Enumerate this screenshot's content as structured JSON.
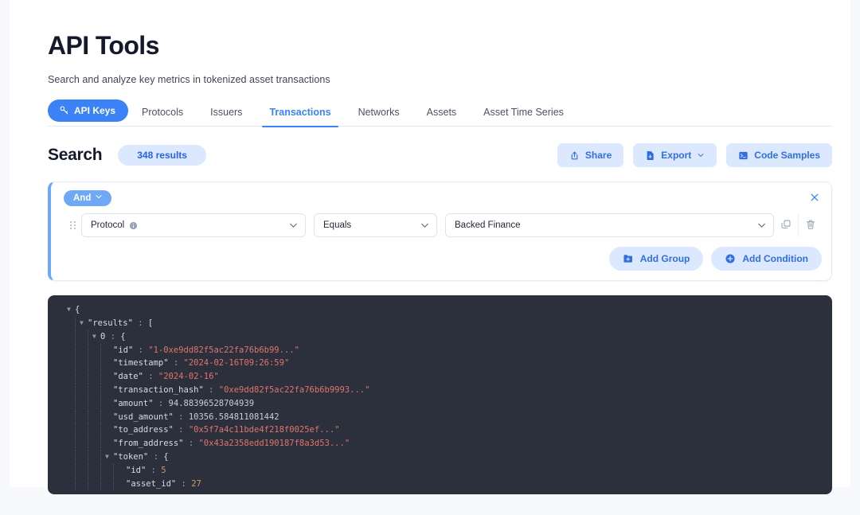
{
  "header": {
    "title": "API Tools",
    "subtitle": "Search and analyze key metrics in tokenized asset transactions"
  },
  "tabs": {
    "pill": {
      "label": "API Keys",
      "icon": "key-icon"
    },
    "items": [
      {
        "label": "Protocols",
        "active": false
      },
      {
        "label": "Issuers",
        "active": false
      },
      {
        "label": "Transactions",
        "active": true
      },
      {
        "label": "Networks",
        "active": false
      },
      {
        "label": "Assets",
        "active": false
      },
      {
        "label": "Asset Time Series",
        "active": false
      }
    ]
  },
  "search": {
    "label": "Search",
    "results_badge": "348 results",
    "actions": [
      {
        "label": "Share",
        "icon": "share-upload-icon"
      },
      {
        "label": "Export",
        "icon": "file-download-icon",
        "caret": true
      },
      {
        "label": "Code Samples",
        "icon": "terminal-icon"
      }
    ]
  },
  "query_builder": {
    "combinator": "And",
    "close_label": "✕",
    "condition": {
      "field": "Protocol",
      "field_info_tooltip": "info-icon",
      "operator": "Equals",
      "value": "Backed Finance",
      "duplicate_icon": "copy-icon",
      "delete_icon": "trash-icon",
      "drag_icon": "drag-handle-icon"
    },
    "add_group_label": "Add Group",
    "add_condition_label": "Add Condition"
  },
  "json_viewer": {
    "lines": [
      {
        "indent": 0,
        "tri": "down",
        "html": "<span class=\"brk\">{</span>"
      },
      {
        "indent": 1,
        "tri": "down",
        "html": "<span class=\"k\">\"results\"</span><span class=\"p\"> : </span><span class=\"brk\">[</span>"
      },
      {
        "indent": 2,
        "tri": "down",
        "html": "<span class=\"k\">0</span><span class=\"p\"> : </span><span class=\"brk\">{</span>"
      },
      {
        "indent": 3,
        "tri": "none",
        "html": "<span class=\"k\">\"id\"</span><span class=\"p\"> : </span><span class=\"str\">\"1-0xe9dd82f5ac22fa76b6b99...\"</span>"
      },
      {
        "indent": 3,
        "tri": "none",
        "html": "<span class=\"k\">\"timestamp\"</span><span class=\"p\"> : </span><span class=\"str\">\"2024-02-16T09:26:59\"</span>"
      },
      {
        "indent": 3,
        "tri": "none",
        "html": "<span class=\"k\">\"date\"</span><span class=\"p\"> : </span><span class=\"str\">\"2024-02-16\"</span>"
      },
      {
        "indent": 3,
        "tri": "none",
        "html": "<span class=\"k\">\"transaction_hash\"</span><span class=\"p\"> : </span><span class=\"str\">\"0xe9dd82f5ac22fa76b6b9993...\"</span>"
      },
      {
        "indent": 3,
        "tri": "none",
        "html": "<span class=\"k\">\"amount\"</span><span class=\"p\"> : </span><span class=\"numf\">94.88396528704939</span>"
      },
      {
        "indent": 3,
        "tri": "none",
        "html": "<span class=\"k\">\"usd_amount\"</span><span class=\"p\"> : </span><span class=\"numf\">10356.584811081442</span>"
      },
      {
        "indent": 3,
        "tri": "none",
        "html": "<span class=\"k\">\"to_address\"</span><span class=\"p\"> : </span><span class=\"str\">\"0x5f7a4c11bde4f218f0025ef...\"</span>"
      },
      {
        "indent": 3,
        "tri": "none",
        "html": "<span class=\"k\">\"from_address\"</span><span class=\"p\"> : </span><span class=\"str\">\"0x43a2358edd190187f8a3d53...\"</span>"
      },
      {
        "indent": 3,
        "tri": "down",
        "html": "<span class=\"k\">\"token\"</span><span class=\"p\"> : </span><span class=\"brk\">{</span>"
      },
      {
        "indent": 4,
        "tri": "none",
        "html": "<span class=\"k\">\"id\"</span><span class=\"p\"> : </span><span class=\"num\">5</span>"
      },
      {
        "indent": 4,
        "tri": "none",
        "html": "<span class=\"k\">\"asset_id\"</span><span class=\"p\"> : </span><span class=\"num\">27</span>"
      }
    ],
    "raw_values": {
      "results_0_id": "1-0xe9dd82f5ac22fa76b6b99...",
      "results_0_timestamp": "2024-02-16T09:26:59",
      "results_0_date": "2024-02-16",
      "results_0_transaction_hash": "0xe9dd82f5ac22fa76b6b9993...",
      "results_0_amount": 94.88396528704939,
      "results_0_usd_amount": 10356.584811081442,
      "results_0_to_address": "0x5f7a4c11bde4f218f0025ef...",
      "results_0_from_address": "0x43a2358edd190187f8a3d53...",
      "results_0_token_id": 5,
      "results_0_token_asset_id": 27
    }
  },
  "colors": {
    "accent": "#3b82f6",
    "accent_soft": "#dbe8fe",
    "combinator": "#6fa8f5",
    "page_bg": "#f7f9fc",
    "code_bg": "#2b303c",
    "code_string": "#e0756a",
    "code_number": "#d19a66"
  }
}
